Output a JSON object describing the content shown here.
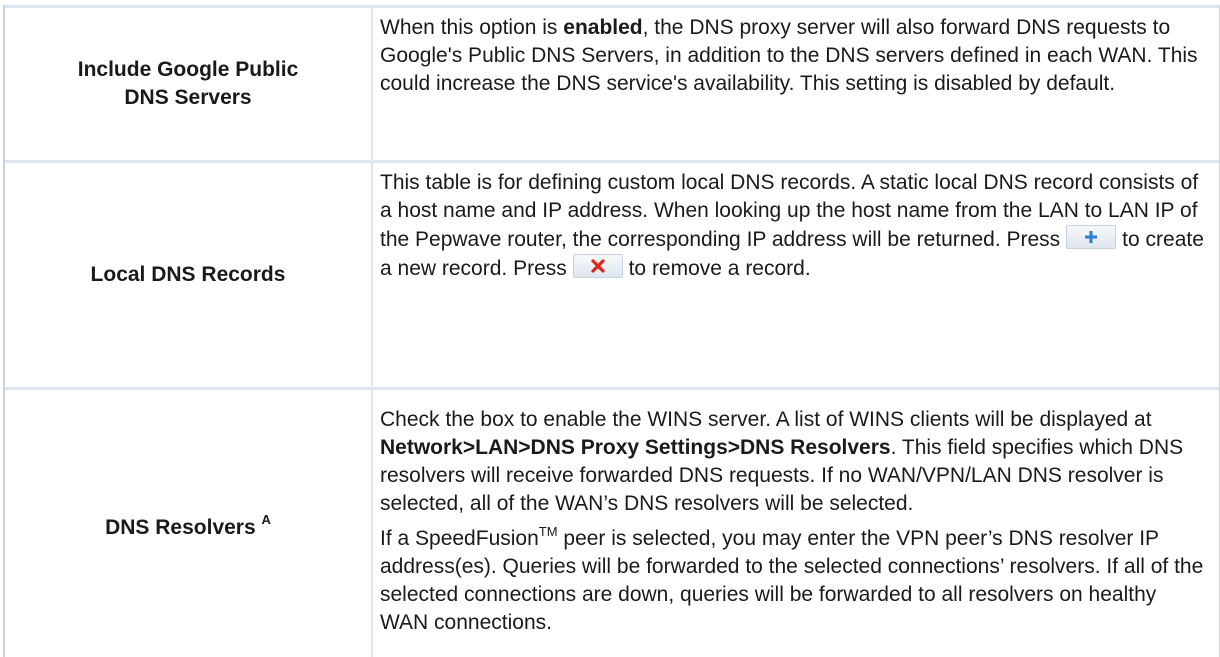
{
  "rows": {
    "google": {
      "label_line1": "Include Google Public",
      "label_line2": "DNS Servers",
      "desc_pre": "When this option is ",
      "desc_bold": "enabled",
      "desc_post": ", the DNS proxy server will also forward DNS requests to Google's Public DNS Servers, in addition to the DNS servers defined in each WAN. This could increase the DNS service's availability. This setting is disabled by default."
    },
    "local": {
      "label": "Local DNS Records",
      "desc_part1": "This table is for defining custom local DNS records. A static local DNS record consists of a host name and IP address. When looking up the host name from the LAN to LAN IP of the Pepwave router, the corresponding IP address will be returned. Press",
      "desc_part2": "to create a new record. Press",
      "desc_part3": "to remove a record.",
      "add_icon": "plus-icon",
      "remove_icon": "red-x-icon"
    },
    "dns": {
      "label": "DNS Resolvers",
      "label_sup": "A",
      "desc_part1": "Check the box to enable the WINS server. A list of WINS clients will be displayed at ",
      "desc_bold": "Network>LAN>DNS Proxy Settings>DNS Resolvers",
      "desc_part2": ". This field specifies which DNS resolvers will receive forwarded DNS requests. If no WAN/VPN/LAN DNS resolver is selected, all of the WAN’s DNS resolvers will be selected.",
      "desc_part3": "If a SpeedFusion",
      "desc_tm": "TM",
      "desc_part4": " peer is selected, you may enter the VPN peer’s DNS resolver IP address(es). Queries will be forwarded to the selected connections’ resolvers. If all of the selected connections are down, queries will be forwarded to all resolvers on healthy WAN connections."
    }
  },
  "colors": {
    "border": "#dde5ee",
    "plus": "#2a7fd4",
    "remove": "#e0241b"
  }
}
